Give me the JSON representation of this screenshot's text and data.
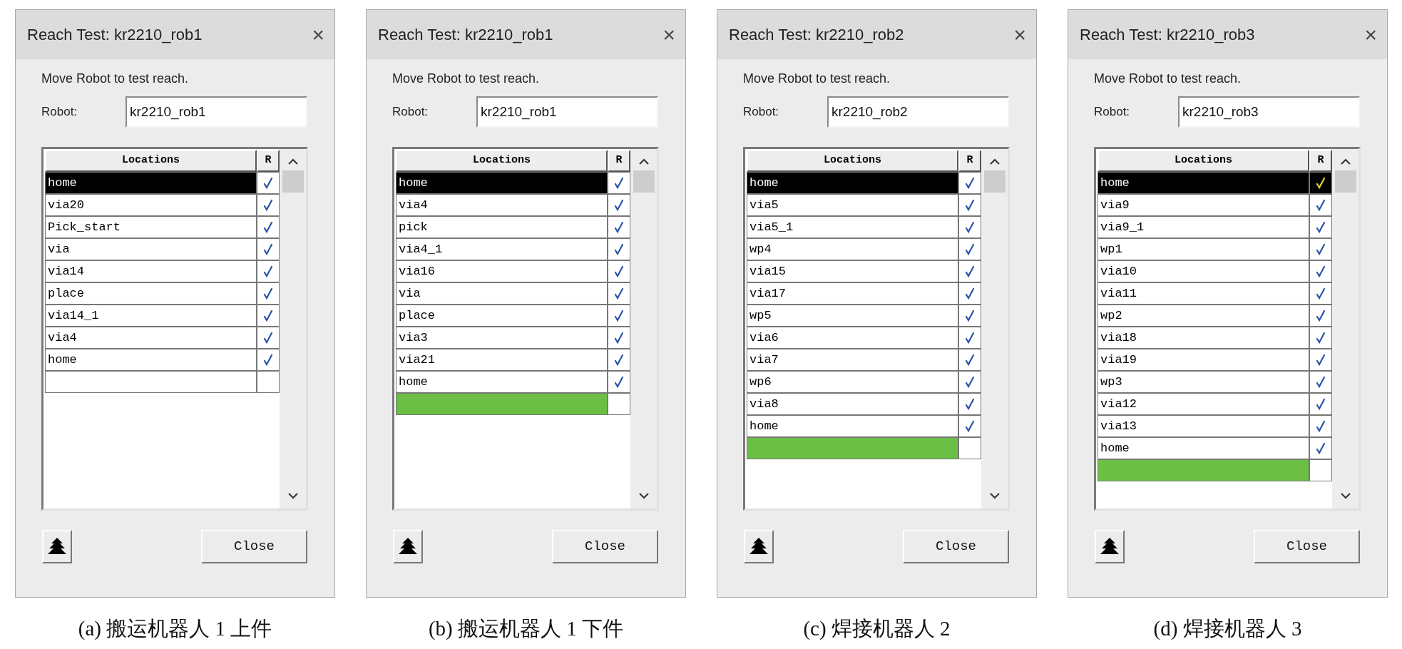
{
  "dialogs": [
    {
      "title": "Reach Test: kr2210_rob1",
      "close_glyph": "×",
      "instruction": "Move Robot to test reach.",
      "robot_label": "Robot:",
      "robot_value": "kr2210_rob1",
      "columns": [
        "Locations",
        "R"
      ],
      "selection_covers_r": false,
      "rows": [
        {
          "kind": "location",
          "name": "home",
          "selected": true,
          "reachable": true
        },
        {
          "kind": "location",
          "name": "via20",
          "selected": false,
          "reachable": true
        },
        {
          "kind": "location",
          "name": "Pick_start",
          "selected": false,
          "reachable": true
        },
        {
          "kind": "location",
          "name": "via",
          "selected": false,
          "reachable": true
        },
        {
          "kind": "location",
          "name": "via14",
          "selected": false,
          "reachable": true
        },
        {
          "kind": "location",
          "name": "place",
          "selected": false,
          "reachable": true
        },
        {
          "kind": "location",
          "name": "via14_1",
          "selected": false,
          "reachable": true
        },
        {
          "kind": "location",
          "name": "via4",
          "selected": false,
          "reachable": true
        },
        {
          "kind": "location",
          "name": "home",
          "selected": false,
          "reachable": true
        },
        {
          "kind": "blank",
          "highlighted": false
        }
      ],
      "close_button": "Close",
      "caption": "(a) 搬运机器人 1 上件"
    },
    {
      "title": "Reach Test: kr2210_rob1",
      "close_glyph": "×",
      "instruction": "Move Robot to test reach.",
      "robot_label": "Robot:",
      "robot_value": "kr2210_rob1",
      "columns": [
        "Locations",
        "R"
      ],
      "selection_covers_r": false,
      "rows": [
        {
          "kind": "location",
          "name": "home",
          "selected": true,
          "reachable": true
        },
        {
          "kind": "location",
          "name": "via4",
          "selected": false,
          "reachable": true
        },
        {
          "kind": "location",
          "name": "pick",
          "selected": false,
          "reachable": true
        },
        {
          "kind": "location",
          "name": "via4_1",
          "selected": false,
          "reachable": true
        },
        {
          "kind": "location",
          "name": "via16",
          "selected": false,
          "reachable": true
        },
        {
          "kind": "location",
          "name": "via",
          "selected": false,
          "reachable": true
        },
        {
          "kind": "location",
          "name": "place",
          "selected": false,
          "reachable": true
        },
        {
          "kind": "location",
          "name": "via3",
          "selected": false,
          "reachable": true
        },
        {
          "kind": "location",
          "name": "via21",
          "selected": false,
          "reachable": true
        },
        {
          "kind": "location",
          "name": "home",
          "selected": false,
          "reachable": true
        },
        {
          "kind": "blank",
          "highlighted": true
        }
      ],
      "close_button": "Close",
      "caption": "(b) 搬运机器人 1 下件"
    },
    {
      "title": "Reach Test: kr2210_rob2",
      "close_glyph": "×",
      "instruction": "Move Robot to test reach.",
      "robot_label": "Robot:",
      "robot_value": "kr2210_rob2",
      "columns": [
        "Locations",
        "R"
      ],
      "selection_covers_r": false,
      "rows": [
        {
          "kind": "location",
          "name": "home",
          "selected": true,
          "reachable": true
        },
        {
          "kind": "location",
          "name": "via5",
          "selected": false,
          "reachable": true
        },
        {
          "kind": "location",
          "name": "via5_1",
          "selected": false,
          "reachable": true
        },
        {
          "kind": "location",
          "name": "wp4",
          "selected": false,
          "reachable": true
        },
        {
          "kind": "location",
          "name": "via15",
          "selected": false,
          "reachable": true
        },
        {
          "kind": "location",
          "name": "via17",
          "selected": false,
          "reachable": true
        },
        {
          "kind": "location",
          "name": "wp5",
          "selected": false,
          "reachable": true
        },
        {
          "kind": "location",
          "name": "via6",
          "selected": false,
          "reachable": true
        },
        {
          "kind": "location",
          "name": "via7",
          "selected": false,
          "reachable": true
        },
        {
          "kind": "location",
          "name": "wp6",
          "selected": false,
          "reachable": true
        },
        {
          "kind": "location",
          "name": "via8",
          "selected": false,
          "reachable": true
        },
        {
          "kind": "location",
          "name": "home",
          "selected": false,
          "reachable": true
        },
        {
          "kind": "blank",
          "highlighted": true
        }
      ],
      "close_button": "Close",
      "caption": "(c) 焊接机器人 2"
    },
    {
      "title": "Reach Test: kr2210_rob3",
      "close_glyph": "×",
      "instruction": "Move Robot to test reach.",
      "robot_label": "Robot:",
      "robot_value": "kr2210_rob3",
      "columns": [
        "Locations",
        "R"
      ],
      "selection_covers_r": true,
      "rows": [
        {
          "kind": "location",
          "name": "home",
          "selected": true,
          "reachable": true
        },
        {
          "kind": "location",
          "name": "via9",
          "selected": false,
          "reachable": true
        },
        {
          "kind": "location",
          "name": "via9_1",
          "selected": false,
          "reachable": true
        },
        {
          "kind": "location",
          "name": "wp1",
          "selected": false,
          "reachable": true
        },
        {
          "kind": "location",
          "name": "via10",
          "selected": false,
          "reachable": true
        },
        {
          "kind": "location",
          "name": "via11",
          "selected": false,
          "reachable": true
        },
        {
          "kind": "location",
          "name": "wp2",
          "selected": false,
          "reachable": true
        },
        {
          "kind": "location",
          "name": "via18",
          "selected": false,
          "reachable": true
        },
        {
          "kind": "location",
          "name": "via19",
          "selected": false,
          "reachable": true
        },
        {
          "kind": "location",
          "name": "wp3",
          "selected": false,
          "reachable": true
        },
        {
          "kind": "location",
          "name": "via12",
          "selected": false,
          "reachable": true
        },
        {
          "kind": "location",
          "name": "via13",
          "selected": false,
          "reachable": true
        },
        {
          "kind": "location",
          "name": "home",
          "selected": false,
          "reachable": true
        },
        {
          "kind": "blank",
          "highlighted": true
        }
      ],
      "close_button": "Close",
      "caption": "(d) 焊接机器人 3"
    }
  ]
}
